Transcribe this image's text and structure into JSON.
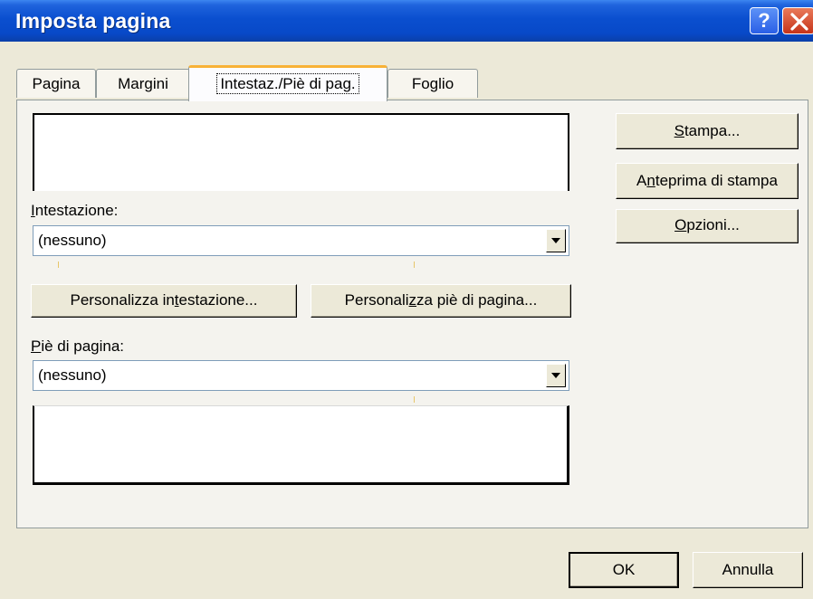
{
  "window": {
    "title": "Imposta pagina",
    "help_glyph": "?",
    "icons": {
      "help": "help-icon",
      "close": "close-icon"
    }
  },
  "tabs": [
    {
      "label": "Pagina",
      "active": false
    },
    {
      "label": "Margini",
      "active": false
    },
    {
      "label": "Intestaz./Piè di pag.",
      "active": true
    },
    {
      "label": "Foglio",
      "active": false
    }
  ],
  "header": {
    "label_key": "I",
    "label_rest": "ntestazione:",
    "value": "(nessuno)"
  },
  "customize": {
    "header_a": "Personalizza in",
    "header_key": "t",
    "header_b": "estazione...",
    "footer_a": "Personali",
    "footer_key": "z",
    "footer_b": "za piè di pagina..."
  },
  "footer": {
    "label_key": "P",
    "label_rest": "iè di pagina:",
    "value": "(nessuno)"
  },
  "side_buttons": {
    "print_key": "S",
    "print_rest": "tampa...",
    "preview_a": "A",
    "preview_key": "n",
    "preview_rest": "teprima di stampa",
    "options_key": "O",
    "options_rest": "pzioni..."
  },
  "dialog_buttons": {
    "ok": "OK",
    "cancel": "Annulla"
  },
  "colors": {
    "titlebar": "#0a4fcf",
    "face": "#ece9d8",
    "active_tab_highlight": "#f8b237"
  }
}
